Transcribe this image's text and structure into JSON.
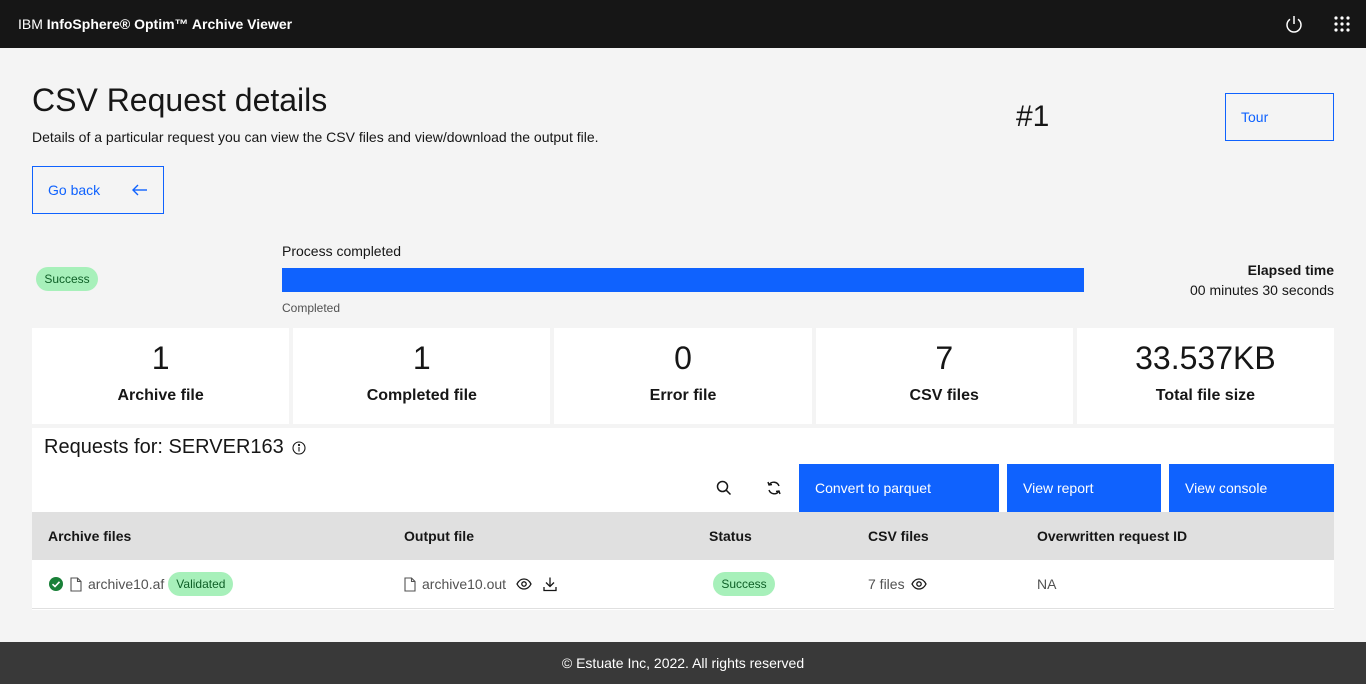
{
  "header": {
    "brand_prefix": "IBM",
    "brand_name": "InfoSphere® Optim™ Archive Viewer",
    "icons": [
      "power-icon",
      "app-switcher-icon"
    ]
  },
  "page": {
    "title": "CSV Request details",
    "subtitle": "Details of a particular request you can view the CSV files and view/download the output file.",
    "request_number": "#1",
    "tour_label": "Tour",
    "back_label": "Go back"
  },
  "progress": {
    "status": "Success",
    "label": "Process completed",
    "helper": "Completed",
    "percent": 100,
    "elapsed_label": "Elapsed time",
    "elapsed_value": "00 minutes 30 seconds"
  },
  "stats": [
    {
      "value": "1",
      "label": "Archive file"
    },
    {
      "value": "1",
      "label": "Completed file"
    },
    {
      "value": "0",
      "label": "Error file"
    },
    {
      "value": "7",
      "label": "CSV files"
    },
    {
      "value": "33.537KB",
      "label": "Total file size"
    }
  ],
  "table": {
    "title": "Requests for: SERVER163",
    "buttons": {
      "convert": "Convert to parquet",
      "report": "View report",
      "console": "View console"
    },
    "columns": [
      "Archive files",
      "Output file",
      "Status",
      "CSV files",
      "Overwritten request ID"
    ],
    "rows": [
      {
        "archive_file": "archive10.af",
        "archive_tag": "Validated",
        "output_file": "archive10.out",
        "status": "Success",
        "csv_files": "7 files",
        "overwritten_id": "NA"
      }
    ]
  },
  "footer": {
    "text": "© Estuate Inc, 2022.  All rights reserved"
  },
  "colors": {
    "primary": "#0f62fe",
    "success_bg": "#a7f0ba",
    "success_text": "#0e6027",
    "header_bg": "#161616",
    "footer_bg": "#393939"
  }
}
